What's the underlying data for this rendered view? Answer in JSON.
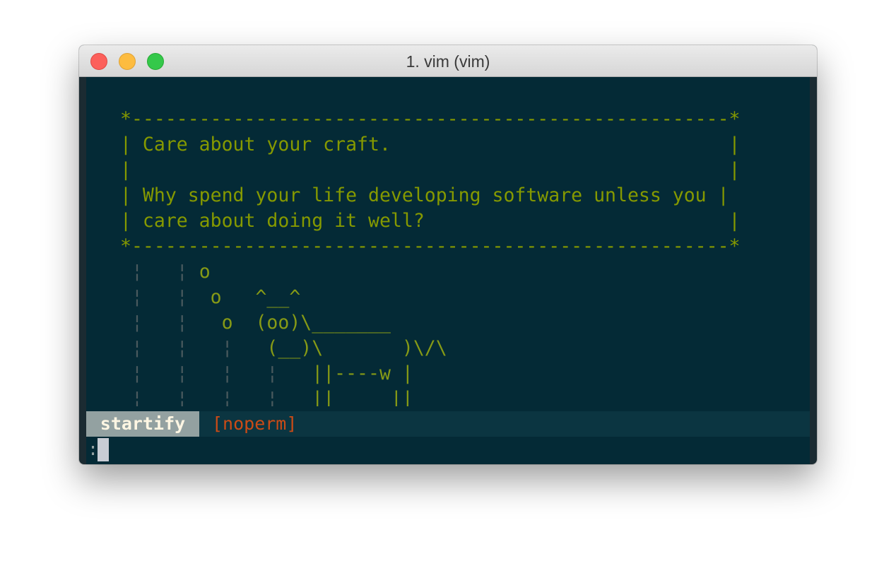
{
  "window": {
    "title": "1. vim (vim)"
  },
  "fortune_box": {
    "top_border": "*-----------------------------------------------------*",
    "line1": "| Care about your craft.                              |",
    "line2": "|                                                     |",
    "line3": "| Why spend your life developing software unless you |",
    "line4": "| care about doing it well?                           |",
    "bottom_border": "*-----------------------------------------------------*"
  },
  "cow": {
    "row1_guides": " ¦   ¦ ",
    "row1_text": "o",
    "row2_guides": " ¦   ¦  ",
    "row2_text": "o   ^__^",
    "row3_guides": " ¦   ¦   ",
    "row3_text": "o  (oo)\\_______",
    "row4_guides": " ¦   ¦   ¦   ",
    "row4_text": "(__)\\       )\\/\\",
    "row5_guides": " ¦   ¦   ¦   ¦   ",
    "row5_text": "||----w |",
    "row6_guides": " ¦   ¦   ¦   ¦   ",
    "row6_text": "||     ||"
  },
  "statusline": {
    "mode": "startify",
    "flag": "[noperm]"
  },
  "cmdline": {
    "prompt": ":"
  },
  "colors": {
    "terminal_bg": "#042a36",
    "text_green": "#859900",
    "statusline_bg": "#0b3541",
    "mode_bg": "#93a1a1",
    "flag_color": "#cb4b16"
  }
}
